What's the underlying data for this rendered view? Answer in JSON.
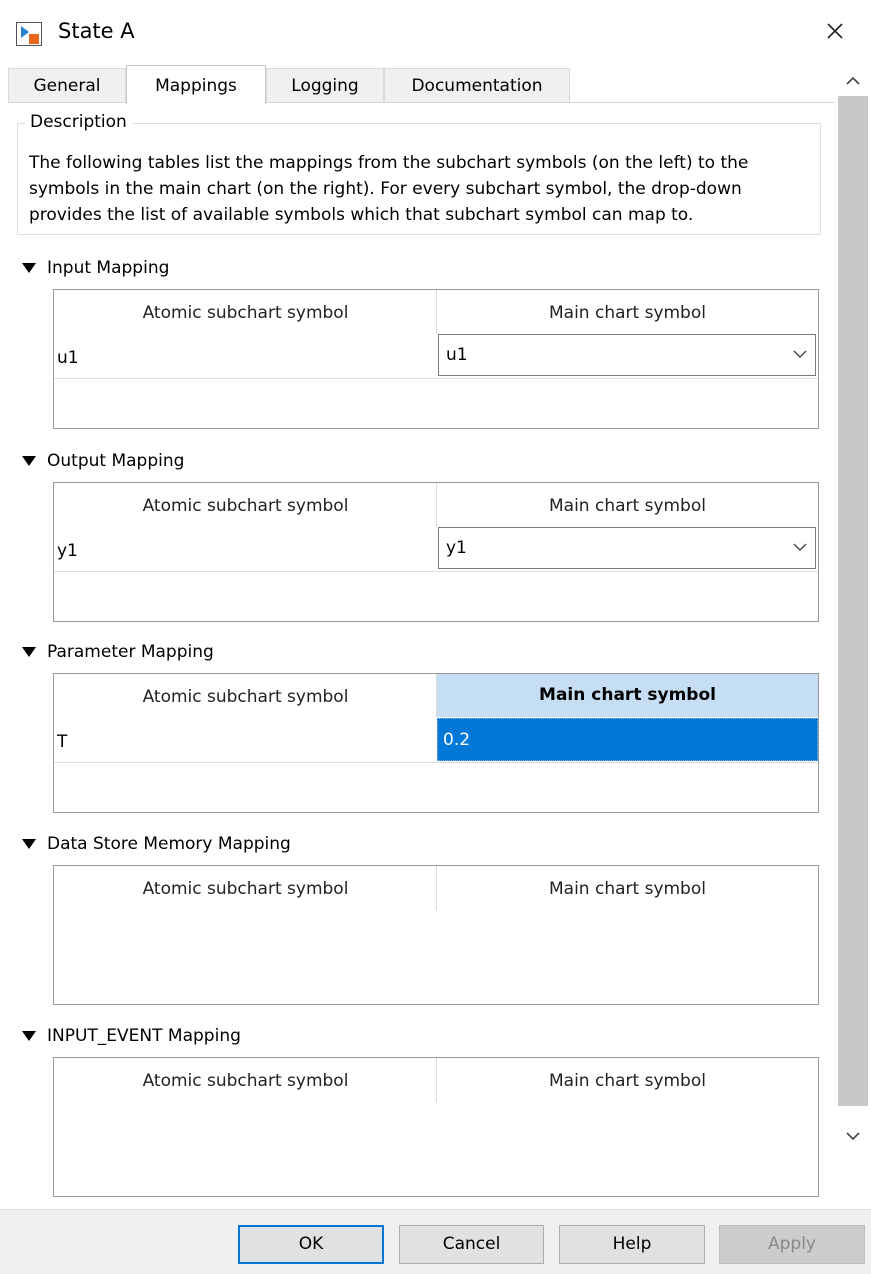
{
  "window": {
    "title": "State A"
  },
  "tabs": [
    {
      "label": "General",
      "active": false
    },
    {
      "label": "Mappings",
      "active": true
    },
    {
      "label": "Logging",
      "active": false
    },
    {
      "label": "Documentation",
      "active": false
    }
  ],
  "description": {
    "legend": "Description",
    "text": "The following tables list the mappings from the subchart symbols (on the left) to the symbols in the main chart (on the right). For every subchart symbol, the drop-down provides the list of available symbols which that subchart symbol can map to."
  },
  "sections": [
    {
      "title": "Input Mapping",
      "col1": "Atomic subchart symbol",
      "col2": "Main chart symbol",
      "rows": [
        {
          "symbol": "u1",
          "value": "u1"
        }
      ]
    },
    {
      "title": "Output Mapping",
      "col1": "Atomic subchart symbol",
      "col2": "Main chart symbol",
      "rows": [
        {
          "symbol": "y1",
          "value": "y1"
        }
      ]
    },
    {
      "title": "Parameter Mapping",
      "col1": "Atomic subchart symbol",
      "col2": "Main chart symbol",
      "rows": [
        {
          "symbol": "T",
          "value": "0.2"
        }
      ]
    },
    {
      "title": "Data Store Memory Mapping",
      "col1": "Atomic subchart symbol",
      "col2": "Main chart symbol",
      "rows": []
    },
    {
      "title": "INPUT_EVENT Mapping",
      "col1": "Atomic subchart symbol",
      "col2": "Main chart symbol",
      "rows": []
    }
  ],
  "buttons": {
    "ok": "OK",
    "cancel": "Cancel",
    "help": "Help",
    "apply": "Apply"
  },
  "colors": {
    "selection": "#0078d7",
    "selected_header": "#c6def3",
    "scrollbar": "#c8c8c8"
  }
}
